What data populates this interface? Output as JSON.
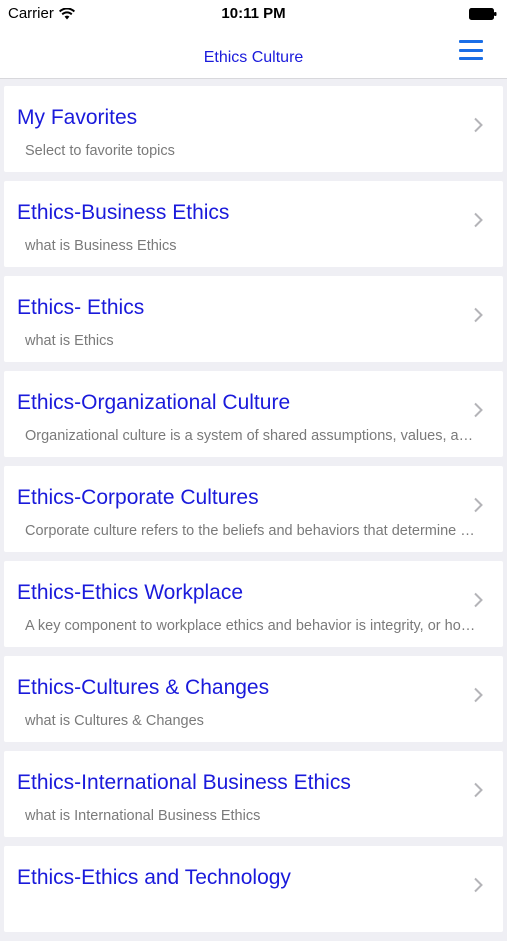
{
  "status_bar": {
    "carrier": "Carrier",
    "time": "10:11 PM"
  },
  "nav": {
    "title": "Ethics Culture",
    "menu_icon": "hamburger-menu-icon"
  },
  "colors": {
    "title_blue": "#1a1adb",
    "menu_blue": "#1a6ee6",
    "subtitle_gray": "#7a7a7a",
    "background": "#efeff4"
  },
  "items": [
    {
      "title": "My Favorites",
      "subtitle": "Select to favorite topics"
    },
    {
      "title": "Ethics-Business Ethics",
      "subtitle": "what is Business Ethics"
    },
    {
      "title": "Ethics- Ethics",
      "subtitle": "what is Ethics"
    },
    {
      "title": "Ethics-Organizational Culture",
      "subtitle": "Organizational culture is a system of shared assumptions, values, and beliefs"
    },
    {
      "title": "Ethics-Corporate Cultures",
      "subtitle": "Corporate culture refers to the beliefs and behaviors that determine how"
    },
    {
      "title": "Ethics-Ethics Workplace",
      "subtitle": "A key component to workplace ethics and behavior is integrity, or honesty"
    },
    {
      "title": "Ethics-Cultures & Changes",
      "subtitle": "what is Cultures & Changes"
    },
    {
      "title": "Ethics-International Business Ethics",
      "subtitle": "what is International Business Ethics"
    },
    {
      "title": "Ethics-Ethics and Technology",
      "subtitle": ""
    }
  ]
}
